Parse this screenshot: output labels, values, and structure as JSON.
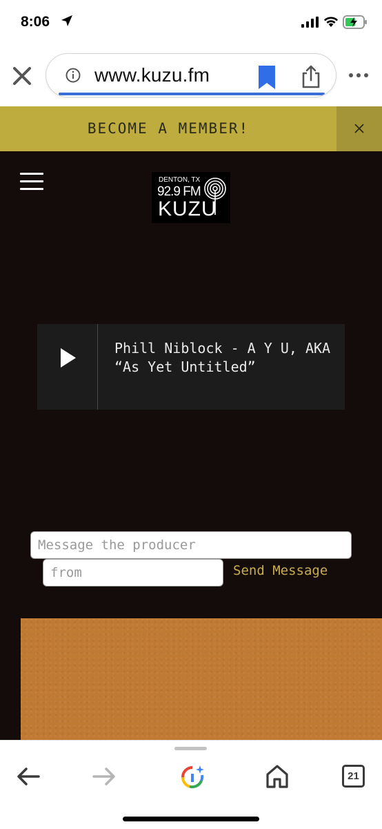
{
  "status_bar": {
    "time": "8:06"
  },
  "browser": {
    "url": "www.kuzu.fm",
    "tab_count": "21"
  },
  "banner": {
    "text": "BECOME A MEMBER!"
  },
  "logo": {
    "line1": "DENTON, TX",
    "line2": "92.9 FM",
    "line3": "KUZU"
  },
  "player": {
    "now_playing": "Phill Niblock - A Y U, AKA “As Yet Untitled”"
  },
  "message_form": {
    "message_placeholder": "Message the producer",
    "from_placeholder": "from",
    "send_label": "Send Message"
  },
  "colors": {
    "banner": "#bfac3f",
    "site_background": "#140c0b",
    "player_background": "#1d1c1c",
    "send_link": "#c9ad4c",
    "album_art": "#c17a34"
  }
}
